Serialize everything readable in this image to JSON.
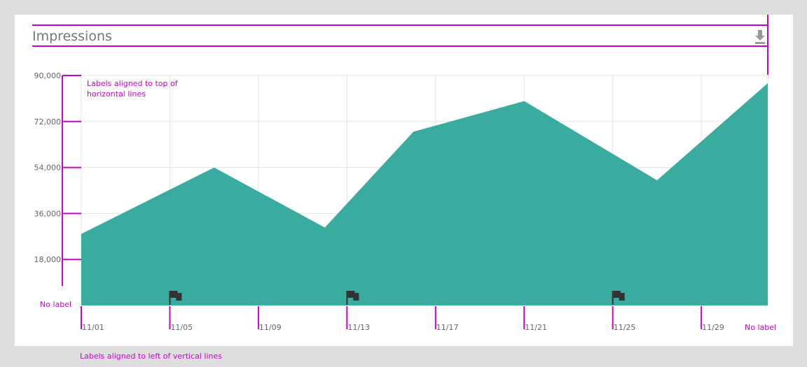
{
  "title": "Impressions",
  "download_icon": "download-icon",
  "colors": {
    "area": "#2fa89a",
    "grid": "#e3e3e3",
    "annotation": "#cc00cc",
    "flag": "#333333",
    "title": "#777777",
    "tick": "#666666"
  },
  "annotations": {
    "labels_top": [
      "Labels aligned to top of",
      "horizontal lines"
    ],
    "labels_left": "Labels aligned to left of vertical lines",
    "no_label_y": "No label",
    "no_label_x": "No label"
  },
  "chart_data": {
    "type": "area",
    "title": "Impressions",
    "xlabel": "",
    "ylabel": "",
    "x_ticks": [
      "11/01",
      "11/05",
      "11/09",
      "11/13",
      "11/17",
      "11/21",
      "11/25",
      "11/29"
    ],
    "y_ticks": [
      "18,000",
      "36,000",
      "54,000",
      "72,000",
      "90,000"
    ],
    "ylim": [
      0,
      90000
    ],
    "xlim": [
      "11/01",
      "12/02"
    ],
    "grid": true,
    "series": [
      {
        "x": [
          "11/01",
          "11/07",
          "11/12",
          "11/16",
          "11/21",
          "11/27",
          "12/02"
        ],
        "values": [
          28000,
          54000,
          30500,
          68000,
          80000,
          49000,
          87000
        ]
      }
    ],
    "flags_at": [
      "11/05",
      "11/13",
      "11/25"
    ]
  }
}
